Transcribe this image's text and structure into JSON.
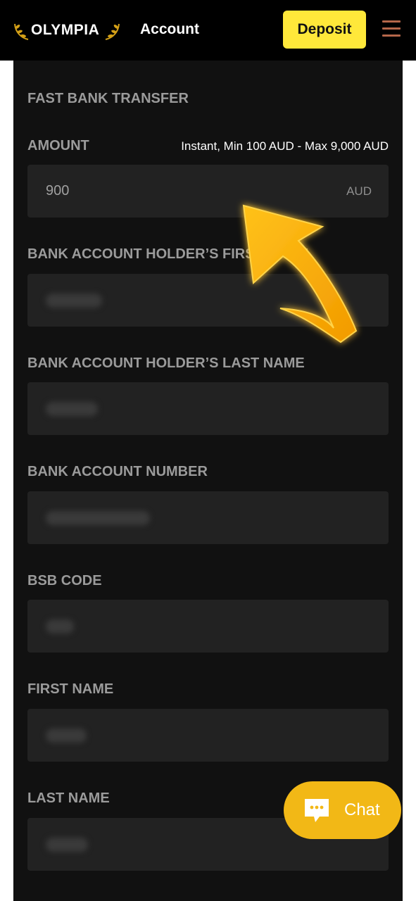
{
  "header": {
    "brand": "OLYMPIA",
    "title": "Account",
    "deposit_label": "Deposit"
  },
  "form": {
    "section_title": "FAST BANK TRANSFER",
    "amount": {
      "label": "AMOUNT",
      "hint": "Instant, Min 100 AUD - Max 9,000 AUD",
      "value": "900",
      "currency": "AUD"
    },
    "fields": [
      {
        "label": "BANK ACCOUNT HOLDER’S FIRST NAME"
      },
      {
        "label": "BANK ACCOUNT HOLDER’S LAST NAME"
      },
      {
        "label": "BANK ACCOUNT NUMBER"
      },
      {
        "label": "BSB CODE"
      },
      {
        "label": "FIRST NAME"
      },
      {
        "label": "LAST NAME"
      }
    ]
  },
  "chat": {
    "label": "Chat"
  },
  "colors": {
    "accent_yellow": "#ffe83a",
    "chat_yellow": "#f2b816",
    "panel_bg": "#111111",
    "field_bg": "#222222",
    "menu_icon": "#b5674a"
  },
  "icons": [
    "laurel-icon",
    "menu-icon",
    "arrow-pointer-icon",
    "chat-bubble-icon"
  ]
}
